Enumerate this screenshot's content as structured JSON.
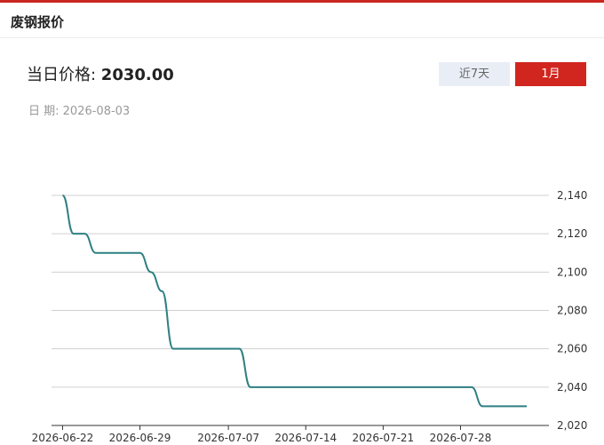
{
  "header": {
    "title": "废钢报价"
  },
  "price": {
    "label": "当日价格: ",
    "value": "2030.00"
  },
  "date": {
    "label": "日 期:",
    "value": "2026-08-03"
  },
  "tabs": [
    {
      "label": "近7天",
      "active": false
    },
    {
      "label": "1月",
      "active": true
    }
  ],
  "colors": {
    "accent": "#d1261f",
    "line": "#2e7f82",
    "grid": "#d0d0d0",
    "tab_inactive": "#e9eef6"
  },
  "chart_data": {
    "type": "line",
    "title": "",
    "xlabel": "",
    "ylabel": "",
    "ylim": [
      2020,
      2140
    ],
    "yticks": [
      2020,
      2040,
      2060,
      2080,
      2100,
      2120,
      2140
    ],
    "ytick_labels": [
      "2,020",
      "2,040",
      "2,060",
      "2,080",
      "2,100",
      "2,120",
      "2,140"
    ],
    "xtick_labels": [
      "2026-06-22",
      "2026-06-29",
      "2026-07-07",
      "2026-07-14",
      "2026-07-21",
      "2026-07-28"
    ],
    "grid": true,
    "series": [
      {
        "x": [
          "2026-06-22",
          "2026-06-23",
          "2026-06-24",
          "2026-06-25",
          "2026-06-26",
          "2026-06-27",
          "2026-06-28",
          "2026-06-29",
          "2026-06-30",
          "2026-07-01",
          "2026-07-02",
          "2026-07-03",
          "2026-07-04",
          "2026-07-06",
          "2026-07-07",
          "2026-07-08",
          "2026-07-09",
          "2026-07-10",
          "2026-07-11",
          "2026-07-13",
          "2026-07-14",
          "2026-07-15",
          "2026-07-16",
          "2026-07-17",
          "2026-07-18",
          "2026-07-20",
          "2026-07-21",
          "2026-07-22",
          "2026-07-23",
          "2026-07-24",
          "2026-07-25",
          "2026-07-27",
          "2026-07-28",
          "2026-07-29",
          "2026-07-30",
          "2026-07-31",
          "2026-08-01",
          "2026-08-03"
        ],
        "values": [
          2140,
          2120,
          2120,
          2110,
          2110,
          2110,
          2110,
          2110,
          2100,
          2090,
          2060,
          2060,
          2060,
          2060,
          2060,
          2060,
          2040,
          2040,
          2040,
          2040,
          2040,
          2040,
          2040,
          2040,
          2040,
          2040,
          2040,
          2040,
          2040,
          2040,
          2040,
          2040,
          2040,
          2040,
          2030,
          2030,
          2030,
          2030
        ]
      }
    ]
  }
}
